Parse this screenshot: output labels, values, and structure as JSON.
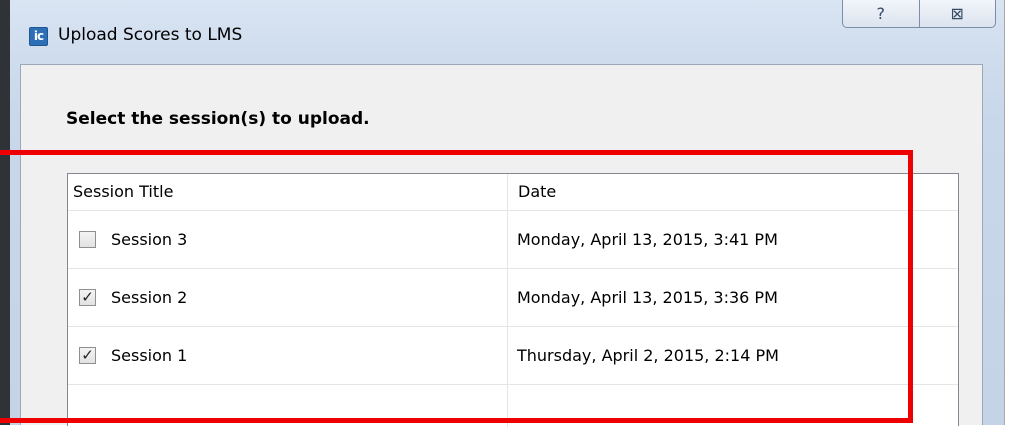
{
  "window": {
    "title": "Upload Scores to LMS",
    "app_icon_text": "ic",
    "help_button": "?",
    "close_button": "⊠"
  },
  "content": {
    "instruction": "Select the session(s) to upload."
  },
  "table": {
    "columns": [
      "Session Title",
      "Date"
    ],
    "rows": [
      {
        "title": "Session 3",
        "date": "Monday, April 13, 2015, 3:41 PM",
        "checked": false,
        "check_glyph": ""
      },
      {
        "title": "Session 2",
        "date": "Monday, April 13, 2015, 3:36 PM",
        "checked": true,
        "check_glyph": "✓"
      },
      {
        "title": "Session 1",
        "date": "Thursday, April 2, 2015, 2:14 PM",
        "checked": true,
        "check_glyph": "✓"
      }
    ]
  },
  "colors": {
    "highlight": "#ee0000",
    "title_bar": "#cfdced",
    "client_bg": "#f0f0f0"
  }
}
